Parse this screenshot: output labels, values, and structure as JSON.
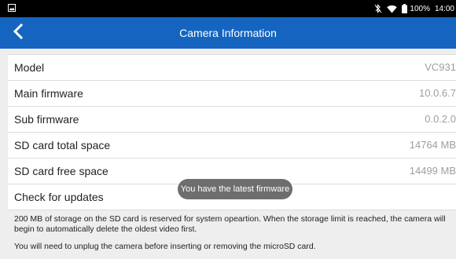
{
  "status_bar": {
    "battery_text": "100%",
    "time": "14:00",
    "icons": [
      "image-icon",
      "bluetooth-off-icon",
      "wifi-icon",
      "battery-icon"
    ]
  },
  "app_bar": {
    "title": "Camera Information",
    "back_icon": "chevron-left-icon",
    "color": "#1565c0"
  },
  "info": {
    "rows": [
      {
        "label": "Model",
        "value": "VC931"
      },
      {
        "label": "Main firmware",
        "value": "10.0.6.7"
      },
      {
        "label": "Sub firmware",
        "value": "0.0.2.0"
      },
      {
        "label": "SD card total space",
        "value": "14764 MB"
      },
      {
        "label": "SD card free space",
        "value": "14499 MB"
      },
      {
        "label": "Check for updates",
        "value": ""
      }
    ]
  },
  "toast": {
    "text": "You have the latest firmware"
  },
  "notes": {
    "storage": "200 MB of storage on the SD card is reserved for system opeartion. When the storage limit is reached, the camera will begin to automatically delete the oldest video first.",
    "unplug": "You will need to unplug the camera before inserting or removing the microSD card."
  }
}
